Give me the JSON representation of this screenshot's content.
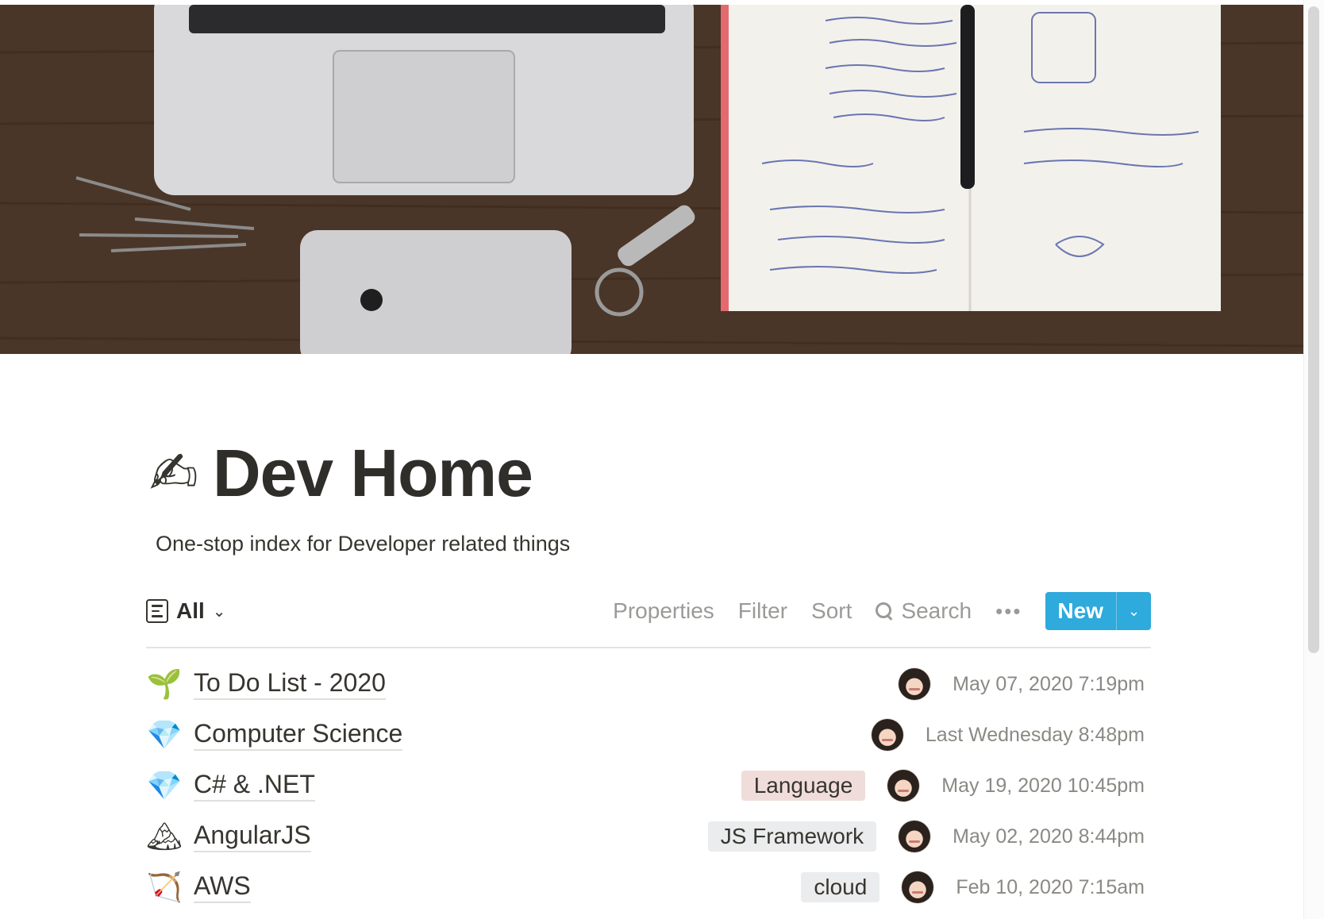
{
  "page": {
    "icon": "✍",
    "title": "Dev Home",
    "description": "One-stop index for Developer related things"
  },
  "toolbar": {
    "view_icon": "list-view-icon",
    "view_label": "All",
    "properties": "Properties",
    "filter": "Filter",
    "sort": "Sort",
    "search": "Search",
    "more": "•••",
    "new": "New"
  },
  "colors": {
    "accent": "#2eaadc",
    "tag_language": "#f0ddd9",
    "tag_gray": "#ebeced"
  },
  "rows": [
    {
      "icon": "🌱",
      "title": "To Do List - 2020",
      "tag": "",
      "date": "May 07, 2020 7:19pm"
    },
    {
      "icon": "💎",
      "title": "Computer Science",
      "tag": "",
      "date": "Last Wednesday 8:48pm"
    },
    {
      "icon": "💎",
      "title": "C# & .NET",
      "tag": "Language",
      "date": "May 19, 2020 10:45pm"
    },
    {
      "icon": "🏔",
      "title": "AngularJS",
      "tag": "JS Framework",
      "date": "May 02, 2020 8:44pm"
    },
    {
      "icon": "🏹",
      "title": "AWS",
      "tag": "cloud",
      "date": "Feb 10, 2020 7:15am"
    }
  ]
}
